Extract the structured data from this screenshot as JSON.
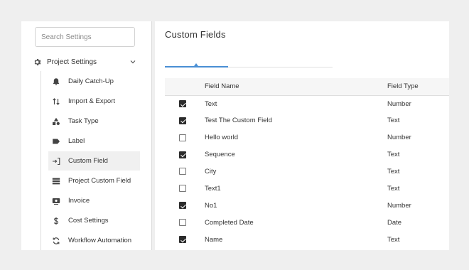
{
  "sidebar": {
    "search_placeholder": "Search Settings",
    "group": {
      "label": "Project Settings",
      "icon": "gear-icon",
      "expanded": true
    },
    "items": [
      {
        "label": "Daily Catch-Up",
        "icon": "bell-icon",
        "active": false
      },
      {
        "label": "Import & Export",
        "icon": "import-export-icon",
        "active": false
      },
      {
        "label": "Task Type",
        "icon": "shapes-icon",
        "active": false
      },
      {
        "label": "Label",
        "icon": "tag-icon",
        "active": false
      },
      {
        "label": "Custom Field",
        "icon": "field-input-icon",
        "active": true
      },
      {
        "label": "Project Custom Field",
        "icon": "list-icon",
        "active": false
      },
      {
        "label": "Invoice",
        "icon": "invoice-icon",
        "active": false
      },
      {
        "label": "Cost Settings",
        "icon": "dollar-icon",
        "active": false
      },
      {
        "label": "Workflow Automation",
        "icon": "refresh-icon",
        "active": false
      }
    ]
  },
  "main": {
    "title": "Custom Fields",
    "table": {
      "headers": {
        "name": "Field Name",
        "type": "Field Type"
      },
      "rows": [
        {
          "checked": true,
          "name": "Text",
          "type": "Number"
        },
        {
          "checked": true,
          "name": "Test The Custom Field",
          "type": "Text"
        },
        {
          "checked": false,
          "name": "Hello world",
          "type": "Number"
        },
        {
          "checked": true,
          "name": "Sequence",
          "type": "Text"
        },
        {
          "checked": false,
          "name": "City",
          "type": "Text"
        },
        {
          "checked": false,
          "name": "Text1",
          "type": "Text"
        },
        {
          "checked": true,
          "name": "No1",
          "type": "Number"
        },
        {
          "checked": false,
          "name": "Completed Date",
          "type": "Date"
        },
        {
          "checked": true,
          "name": "Name",
          "type": "Text"
        }
      ]
    }
  },
  "colors": {
    "accent": "#4a8fd4",
    "background": "#efefef",
    "panel": "#ffffff",
    "active_item": "#f0f0f0",
    "checkbox_checked": "#2b2b2b"
  }
}
